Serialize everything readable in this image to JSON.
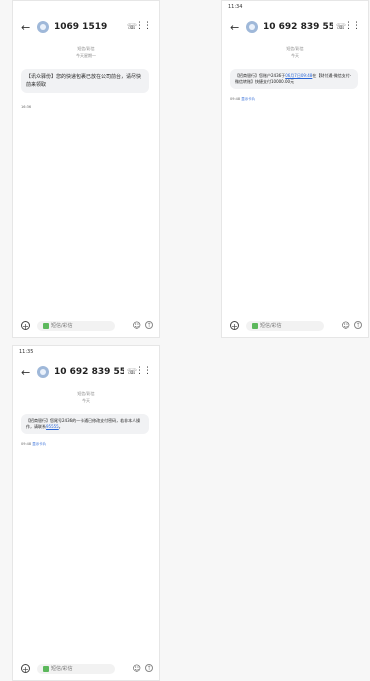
{
  "screens": [
    {
      "status": {
        "time": "",
        "icons": ""
      },
      "title": "1069 1519",
      "meta": {
        "line1": "短信/彩信",
        "line2": "今天星期一"
      },
      "message": {
        "text": "【讯众驿份】您的快递包裹已放在公司前台，请尽快前来领取",
        "link": "",
        "text_after": "",
        "sub": "16:36",
        "hint": ""
      },
      "input_placeholder": "短信/彩信"
    },
    {
      "status": {
        "time": "11:34",
        "icons": ""
      },
      "title": "10 692 839 55...",
      "meta": {
        "line1": "短信/彩信",
        "line2": "今天"
      },
      "message": {
        "text": "【招商银行】您账户2436于",
        "link": "06月7日09:48",
        "text_after": "在【财付通-微信支付-微信转账】快捷支付10000.00元",
        "sub": "09:48",
        "hint": "显示卡片"
      },
      "input_placeholder": "短信/彩信"
    },
    {
      "status": {
        "time": "11:35",
        "icons": ""
      },
      "title": "10 692 839 55...",
      "meta": {
        "line1": "短信/彩信",
        "line2": "今天"
      },
      "message": {
        "text": "【招商银行】您尾号2436的一卡通已修改支付密码，若非本人操作，请联系",
        "link": "95555",
        "text_after": "。",
        "sub": "09:48",
        "hint": "显示卡片"
      },
      "input_placeholder": "短信/彩信"
    }
  ],
  "colors": {
    "accent": "#2a66d6",
    "bubble": "#f1f2f4",
    "sim": "#5cb85c"
  },
  "icons": {
    "back": "arrow-left",
    "phone": "phone-handset",
    "menu": "vertical-dots",
    "add": "plus-circle",
    "emoji": "smile",
    "send": "arrow-up-circle"
  }
}
